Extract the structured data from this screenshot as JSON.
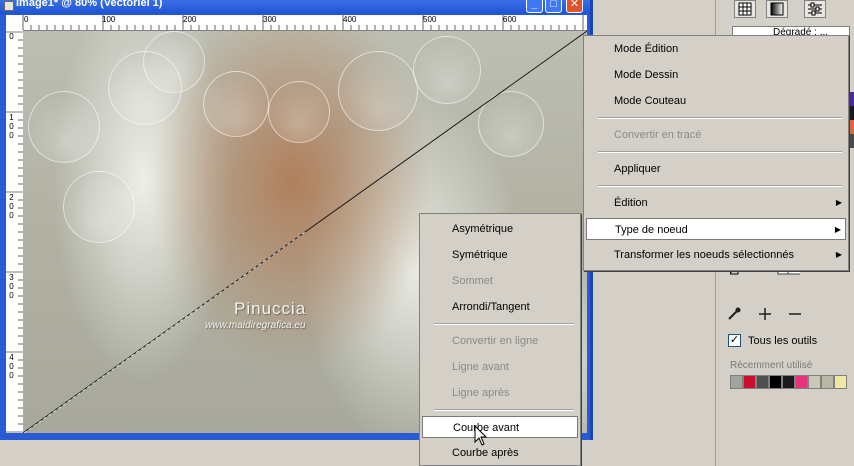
{
  "window": {
    "title": "Image1* @  80% (Vectoriel 1)",
    "minimize_glyph": "_",
    "maximize_glyph": "□",
    "close_glyph": "✕"
  },
  "ruler_top_labels": [
    "0",
    "100",
    "200",
    "300",
    "400",
    "500",
    "600"
  ],
  "ruler_left_labels": [
    [
      "0"
    ],
    [
      "1",
      "0",
      "0"
    ],
    [
      "2",
      "0",
      "0"
    ],
    [
      "3",
      "0",
      "0"
    ],
    [
      "4",
      "0",
      "0"
    ]
  ],
  "watermark": {
    "name": "Pinuccia",
    "url": "www.maidiregrafica.eu"
  },
  "main_menu": {
    "items": [
      {
        "label": "Mode Édition",
        "enabled": true,
        "submenu": false
      },
      {
        "label": "Mode Dessin",
        "enabled": true,
        "submenu": false
      },
      {
        "label": "Mode Couteau",
        "enabled": true,
        "submenu": false
      },
      {
        "label": "Convertir en tracé",
        "enabled": false,
        "submenu": false
      },
      {
        "label": "Appliquer",
        "enabled": true,
        "submenu": false
      },
      {
        "label": "Édition",
        "enabled": true,
        "submenu": true
      },
      {
        "label": "Type de noeud",
        "enabled": true,
        "submenu": true,
        "highlighted": true
      },
      {
        "label": "Transformer les noeuds sélectionnés",
        "enabled": true,
        "submenu": true
      }
    ]
  },
  "sub_menu": {
    "items": [
      {
        "label": "Asymétrique",
        "enabled": true
      },
      {
        "label": "Symétrique",
        "enabled": true
      },
      {
        "label": "Sommet",
        "enabled": false
      },
      {
        "label": "Arrondi/Tangent",
        "enabled": true
      },
      {
        "label": "Convertir en ligne",
        "enabled": false
      },
      {
        "label": "Ligne avant",
        "enabled": false
      },
      {
        "label": "Ligne après",
        "enabled": false
      },
      {
        "label": "Courbe avant",
        "enabled": true,
        "highlighted": true
      },
      {
        "label": "Courbe après",
        "enabled": true
      }
    ]
  },
  "right_panel": {
    "field_text": "Dégradé : ...",
    "all_tools_label": "Tous les outils",
    "all_tools_checked": true,
    "recent_label": "Récemment utilisé",
    "recent_colors": [
      "#9fa49c",
      "#c8102e",
      "#505050",
      "#000000",
      "#1a1a1a",
      "#e8337a",
      "#c9c8b6",
      "#b8b8a8",
      "#f0e8a0"
    ],
    "edge_colors": [
      "#4a2a9a",
      "#1a1a1a",
      "#d86840",
      "#4a4a4a"
    ]
  },
  "icons": {
    "grid": "grid-icon",
    "gradient": "gradient-icon",
    "adjust": "adjust-icon",
    "dropper": "eyedropper-icon",
    "add": "plus-icon",
    "remove": "minus-icon",
    "cursor": "mouse-cursor-icon",
    "submenu_arrow": "▶"
  }
}
